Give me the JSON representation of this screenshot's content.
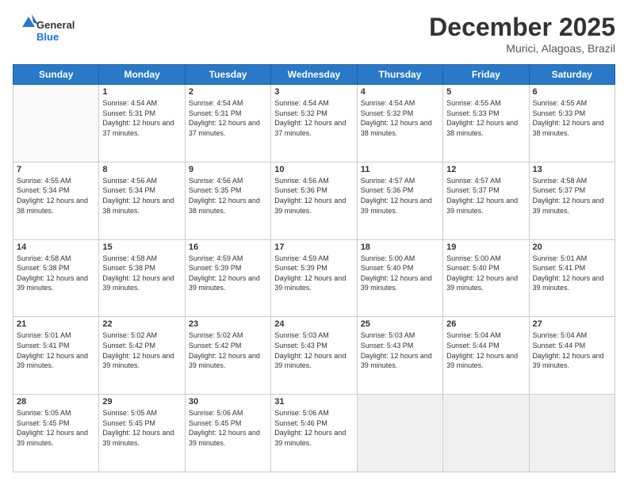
{
  "header": {
    "logo_general": "General",
    "logo_blue": "Blue",
    "month_title": "December 2025",
    "location": "Murici, Alagoas, Brazil"
  },
  "weekdays": [
    "Sunday",
    "Monday",
    "Tuesday",
    "Wednesday",
    "Thursday",
    "Friday",
    "Saturday"
  ],
  "weeks": [
    [
      {
        "day": "",
        "sunrise": "",
        "sunset": "",
        "daylight": "",
        "empty": true
      },
      {
        "day": "1",
        "sunrise": "4:54 AM",
        "sunset": "5:31 PM",
        "daylight": "12 hours and 37 minutes."
      },
      {
        "day": "2",
        "sunrise": "4:54 AM",
        "sunset": "5:31 PM",
        "daylight": "12 hours and 37 minutes."
      },
      {
        "day": "3",
        "sunrise": "4:54 AM",
        "sunset": "5:32 PM",
        "daylight": "12 hours and 37 minutes."
      },
      {
        "day": "4",
        "sunrise": "4:54 AM",
        "sunset": "5:32 PM",
        "daylight": "12 hours and 38 minutes."
      },
      {
        "day": "5",
        "sunrise": "4:55 AM",
        "sunset": "5:33 PM",
        "daylight": "12 hours and 38 minutes."
      },
      {
        "day": "6",
        "sunrise": "4:55 AM",
        "sunset": "5:33 PM",
        "daylight": "12 hours and 38 minutes."
      }
    ],
    [
      {
        "day": "7",
        "sunrise": "4:55 AM",
        "sunset": "5:34 PM",
        "daylight": "12 hours and 38 minutes."
      },
      {
        "day": "8",
        "sunrise": "4:56 AM",
        "sunset": "5:34 PM",
        "daylight": "12 hours and 38 minutes."
      },
      {
        "day": "9",
        "sunrise": "4:56 AM",
        "sunset": "5:35 PM",
        "daylight": "12 hours and 38 minutes."
      },
      {
        "day": "10",
        "sunrise": "4:56 AM",
        "sunset": "5:36 PM",
        "daylight": "12 hours and 39 minutes."
      },
      {
        "day": "11",
        "sunrise": "4:57 AM",
        "sunset": "5:36 PM",
        "daylight": "12 hours and 39 minutes."
      },
      {
        "day": "12",
        "sunrise": "4:57 AM",
        "sunset": "5:37 PM",
        "daylight": "12 hours and 39 minutes."
      },
      {
        "day": "13",
        "sunrise": "4:58 AM",
        "sunset": "5:37 PM",
        "daylight": "12 hours and 39 minutes."
      }
    ],
    [
      {
        "day": "14",
        "sunrise": "4:58 AM",
        "sunset": "5:38 PM",
        "daylight": "12 hours and 39 minutes."
      },
      {
        "day": "15",
        "sunrise": "4:58 AM",
        "sunset": "5:38 PM",
        "daylight": "12 hours and 39 minutes."
      },
      {
        "day": "16",
        "sunrise": "4:59 AM",
        "sunset": "5:39 PM",
        "daylight": "12 hours and 39 minutes."
      },
      {
        "day": "17",
        "sunrise": "4:59 AM",
        "sunset": "5:39 PM",
        "daylight": "12 hours and 39 minutes."
      },
      {
        "day": "18",
        "sunrise": "5:00 AM",
        "sunset": "5:40 PM",
        "daylight": "12 hours and 39 minutes."
      },
      {
        "day": "19",
        "sunrise": "5:00 AM",
        "sunset": "5:40 PM",
        "daylight": "12 hours and 39 minutes."
      },
      {
        "day": "20",
        "sunrise": "5:01 AM",
        "sunset": "5:41 PM",
        "daylight": "12 hours and 39 minutes."
      }
    ],
    [
      {
        "day": "21",
        "sunrise": "5:01 AM",
        "sunset": "5:41 PM",
        "daylight": "12 hours and 39 minutes."
      },
      {
        "day": "22",
        "sunrise": "5:02 AM",
        "sunset": "5:42 PM",
        "daylight": "12 hours and 39 minutes."
      },
      {
        "day": "23",
        "sunrise": "5:02 AM",
        "sunset": "5:42 PM",
        "daylight": "12 hours and 39 minutes."
      },
      {
        "day": "24",
        "sunrise": "5:03 AM",
        "sunset": "5:43 PM",
        "daylight": "12 hours and 39 minutes."
      },
      {
        "day": "25",
        "sunrise": "5:03 AM",
        "sunset": "5:43 PM",
        "daylight": "12 hours and 39 minutes."
      },
      {
        "day": "26",
        "sunrise": "5:04 AM",
        "sunset": "5:44 PM",
        "daylight": "12 hours and 39 minutes."
      },
      {
        "day": "27",
        "sunrise": "5:04 AM",
        "sunset": "5:44 PM",
        "daylight": "12 hours and 39 minutes."
      }
    ],
    [
      {
        "day": "28",
        "sunrise": "5:05 AM",
        "sunset": "5:45 PM",
        "daylight": "12 hours and 39 minutes."
      },
      {
        "day": "29",
        "sunrise": "5:05 AM",
        "sunset": "5:45 PM",
        "daylight": "12 hours and 39 minutes."
      },
      {
        "day": "30",
        "sunrise": "5:06 AM",
        "sunset": "5:45 PM",
        "daylight": "12 hours and 39 minutes."
      },
      {
        "day": "31",
        "sunrise": "5:06 AM",
        "sunset": "5:46 PM",
        "daylight": "12 hours and 39 minutes."
      },
      {
        "day": "",
        "sunrise": "",
        "sunset": "",
        "daylight": "",
        "empty": true
      },
      {
        "day": "",
        "sunrise": "",
        "sunset": "",
        "daylight": "",
        "empty": true
      },
      {
        "day": "",
        "sunrise": "",
        "sunset": "",
        "daylight": "",
        "empty": true
      }
    ]
  ]
}
